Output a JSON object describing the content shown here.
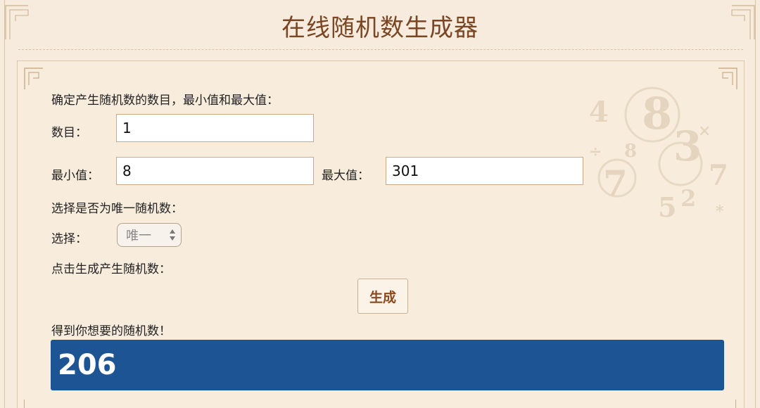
{
  "page": {
    "title": "在线随机数生成器"
  },
  "form": {
    "intro": "确定产生随机数的数目，最小值和最大值：",
    "count_label": "数目：",
    "count_value": "1",
    "min_label": "最小值：",
    "min_value": "8",
    "max_label": "最大值：",
    "max_value": "301",
    "unique_prompt": "选择是否为唯一随机数：",
    "select_label": "选择：",
    "select_value": "唯一",
    "click_prompt": "点击生成产生随机数：",
    "generate_label": "生成",
    "result_prompt": "得到你想要的随机数！",
    "result_value": "206"
  },
  "colors": {
    "background": "#f6ebdc",
    "title": "#7a4624",
    "result_bg": "#1d5493",
    "button_text": "#8a4a20"
  },
  "icons": {
    "select_arrows": "updown-arrows-icon",
    "corner_ornament": "fret-corner-icon",
    "number_decoration": "numbers-decoration-icon"
  }
}
